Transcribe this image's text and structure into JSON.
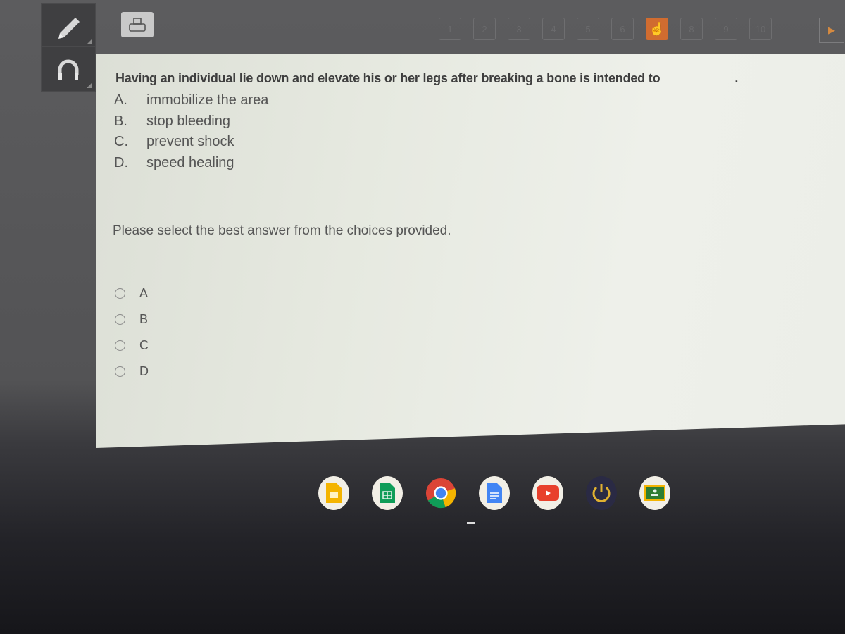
{
  "toolbar": {
    "left_tools": [
      {
        "name": "pencil-icon",
        "label": "Pencil tool"
      },
      {
        "name": "headphones-icon",
        "label": "Audio tool"
      }
    ],
    "print_icon": "printer-icon",
    "pages": [
      "1",
      "2",
      "3",
      "4",
      "5",
      "6",
      "7",
      "8",
      "9",
      "10"
    ],
    "current_page": "7",
    "next_icon": "play-arrow-icon"
  },
  "question": {
    "stem": "Having an individual lie down and elevate his or her legs after breaking a bone is intended to",
    "blank_suffix": ".",
    "choices": [
      {
        "letter": "A.",
        "text": "immobilize the area"
      },
      {
        "letter": "B.",
        "text": "stop bleeding"
      },
      {
        "letter": "C.",
        "text": "prevent shock"
      },
      {
        "letter": "D.",
        "text": "speed healing"
      }
    ],
    "instruction": "Please select the best answer from the choices provided.",
    "answers": [
      {
        "label": "A",
        "selected": false
      },
      {
        "label": "B",
        "selected": false
      },
      {
        "label": "C",
        "selected": false
      },
      {
        "label": "D",
        "selected": false
      }
    ]
  },
  "shelf": {
    "apps": [
      {
        "name": "google-slides-icon",
        "color": "#f4b400"
      },
      {
        "name": "google-sheets-icon",
        "color": "#0f9d58"
      },
      {
        "name": "chrome-icon",
        "color": "#4285f4"
      },
      {
        "name": "google-docs-icon",
        "color": "#4285f4"
      },
      {
        "name": "youtube-icon",
        "color": "#e8402c"
      },
      {
        "name": "power-icon",
        "color": "#e0b030"
      },
      {
        "name": "google-classroom-icon",
        "color": "#2e7d32"
      }
    ]
  }
}
